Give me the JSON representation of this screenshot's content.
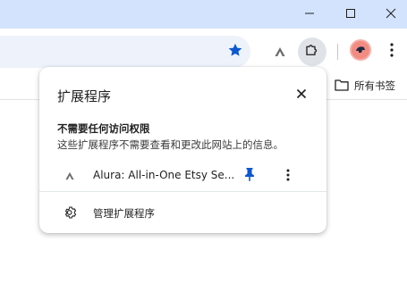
{
  "window_controls": {
    "minimize_icon": "minimize-icon",
    "maximize_icon": "maximize-icon",
    "close_icon": "close-icon"
  },
  "toolbar": {
    "bookmark_star_icon": "star-icon",
    "extension_icon": "alura-icon",
    "extensions_button_icon": "puzzle-icon",
    "profile_icon": "profile-avatar",
    "menu_icon": "more-vert-icon",
    "accent_color": "#0b57d0"
  },
  "bookmarks_bar": {
    "all_bookmarks_label": "所有书签"
  },
  "extensions_popup": {
    "title": "扩展程序",
    "section_heading": "不需要任何访问权限",
    "section_description": "这些扩展程序不需要查看和更改此网站上的信息。",
    "extensions": [
      {
        "name": "Alura: All-in-One Etsy Se...",
        "pinned": true
      }
    ],
    "manage_label": "管理扩展程序"
  }
}
